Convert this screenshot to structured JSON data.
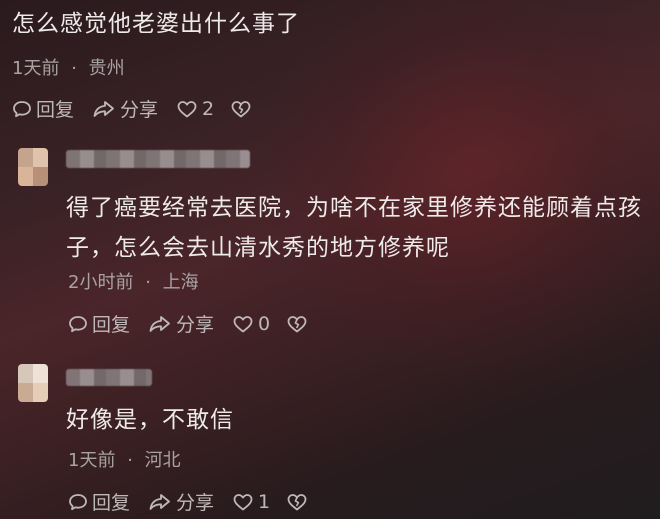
{
  "comment_1": {
    "text": "怎么感觉他老婆出什么事了",
    "time": "1天前",
    "location": "贵州",
    "reply_label": "回复",
    "share_label": "分享",
    "like_count": "2"
  },
  "comment_2": {
    "text_line1": "得了癌要经常去医院，为啥不在家里修养还能顾着点孩",
    "text_line2": "子，怎么会去山清水秀的地方修养呢",
    "time": "2小时前",
    "location": "上海",
    "reply_label": "回复",
    "share_label": "分享",
    "like_count": "0"
  },
  "comment_3": {
    "text": "好像是，不敢信",
    "time": "1天前",
    "location": "河北",
    "reply_label": "回复",
    "share_label": "分享",
    "like_count": "1"
  },
  "separator": "·",
  "icons": {
    "reply": "speech-bubble-icon",
    "share": "share-arrow-icon",
    "like": "heart-icon",
    "dislike": "broken-heart-icon"
  }
}
